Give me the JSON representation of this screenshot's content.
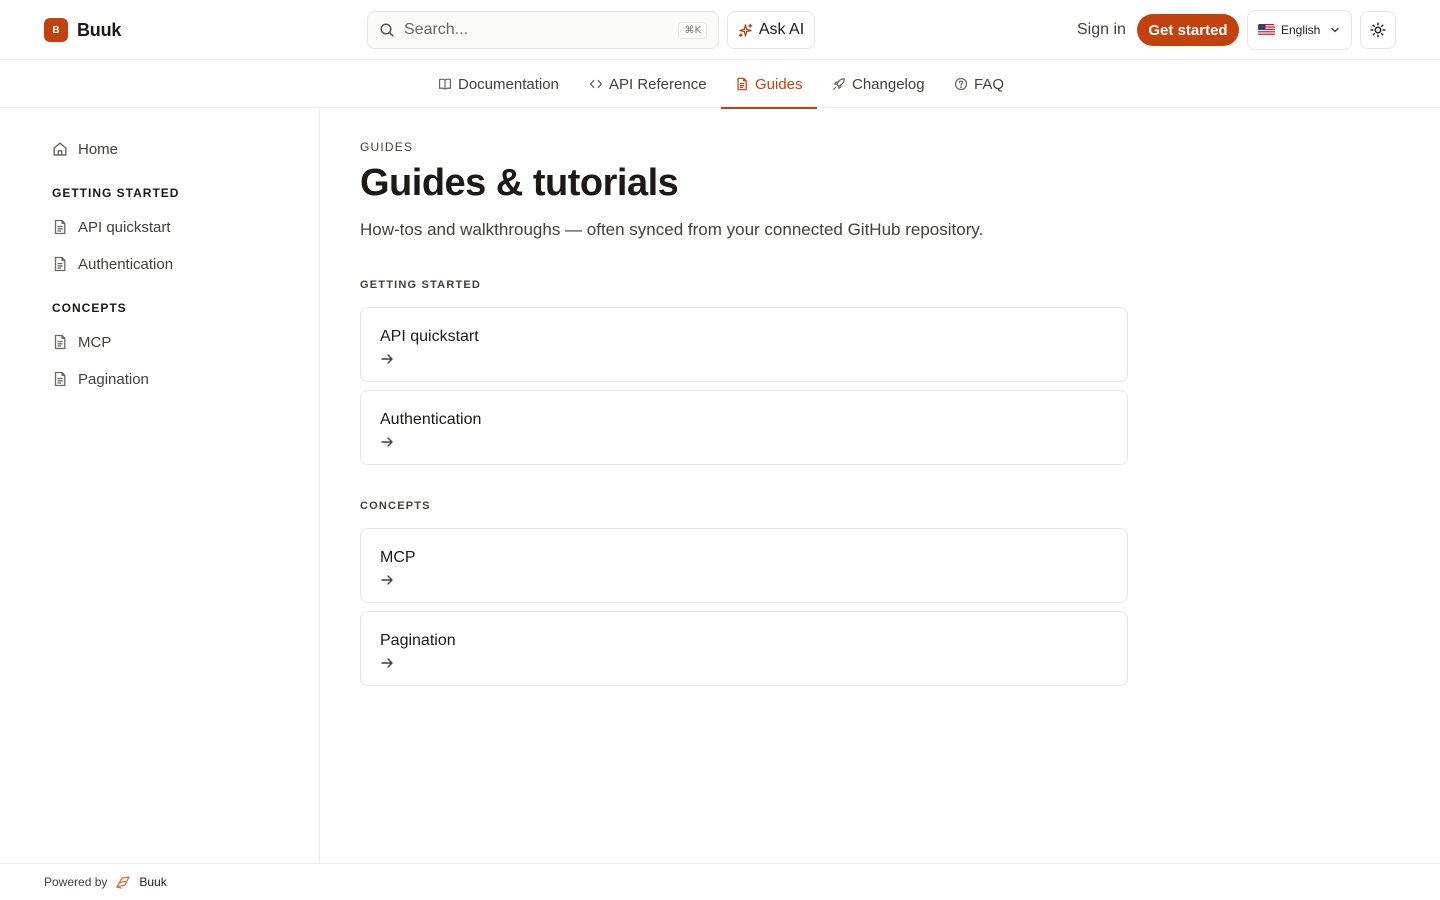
{
  "header": {
    "brand_initial": "B",
    "brand_name": "Buuk",
    "search_placeholder": "Search...",
    "search_shortcut": "⌘K",
    "ask_ai": "Ask AI",
    "sign_in": "Sign in",
    "get_started": "Get started",
    "language": "English"
  },
  "tabs": [
    {
      "label": "Documentation",
      "icon": "book-icon",
      "active": false
    },
    {
      "label": "API Reference",
      "icon": "code-icon",
      "active": false
    },
    {
      "label": "Guides",
      "icon": "file-icon",
      "active": true
    },
    {
      "label": "Changelog",
      "icon": "rocket-icon",
      "active": false
    },
    {
      "label": "FAQ",
      "icon": "help-circle-icon",
      "active": false
    }
  ],
  "sidebar": {
    "home": "Home",
    "sections": [
      {
        "title": "GETTING STARTED",
        "items": [
          "API quickstart",
          "Authentication"
        ]
      },
      {
        "title": "CONCEPTS",
        "items": [
          "MCP",
          "Pagination"
        ]
      }
    ]
  },
  "main": {
    "eyebrow": "GUIDES",
    "title": "Guides & tutorials",
    "description": "How-tos and walkthroughs — often synced from your connected GitHub repository.",
    "sections": [
      {
        "title": "GETTING STARTED",
        "cards": [
          "API quickstart",
          "Authentication"
        ]
      },
      {
        "title": "CONCEPTS",
        "cards": [
          "MCP",
          "Pagination"
        ]
      }
    ]
  },
  "footer": {
    "powered_by": "Powered by",
    "brand": "Buuk"
  },
  "colors": {
    "accent": "#c2410c",
    "border": "#e7e5e4",
    "text": "#1c1917"
  }
}
